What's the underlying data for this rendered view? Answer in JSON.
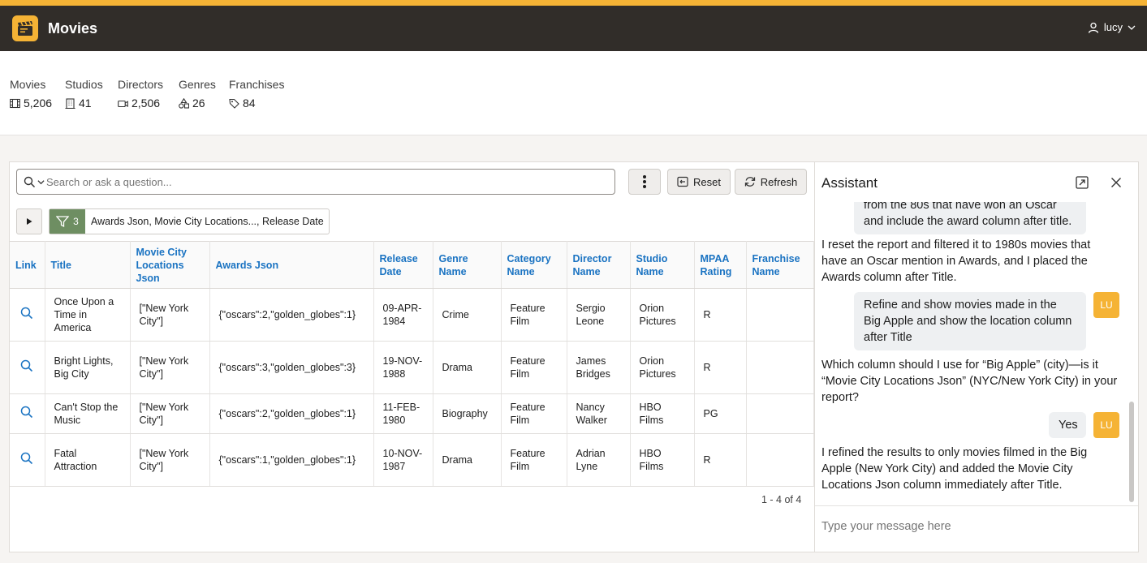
{
  "header": {
    "title": "Movies",
    "user": "lucy"
  },
  "stats": [
    {
      "label": "Movies",
      "value": "5,206",
      "icon": "film-icon"
    },
    {
      "label": "Studios",
      "value": "41",
      "icon": "building-icon"
    },
    {
      "label": "Directors",
      "value": "2,506",
      "icon": "camera-icon"
    },
    {
      "label": "Genres",
      "value": "26",
      "icon": "shapes-icon"
    },
    {
      "label": "Franchises",
      "value": "84",
      "icon": "tag-icon"
    }
  ],
  "toolbar": {
    "search_placeholder": "Search or ask a question...",
    "reset_label": "Reset",
    "refresh_label": "Refresh",
    "filter_count": "3",
    "filter_text": "Awards Json, Movie City Locations..., Release Date"
  },
  "table": {
    "columns": [
      "Link",
      "Title",
      "Movie City Locations Json",
      "Awards Json",
      "Release Date",
      "Genre Name",
      "Category Name",
      "Director Name",
      "Studio Name",
      "MPAA Rating",
      "Franchise Name"
    ],
    "rows": [
      [
        "",
        "Once Upon a Time in America",
        "[\"New York City\"]",
        "{\"oscars\":2,\"golden_globes\":1}",
        "09-APR-1984",
        "Crime",
        "Feature Film",
        "Sergio Leone",
        "Orion Pictures",
        "R",
        ""
      ],
      [
        "",
        "Bright Lights, Big City",
        "[\"New York City\"]",
        "{\"oscars\":3,\"golden_globes\":3}",
        "19-NOV-1988",
        "Drama",
        "Feature Film",
        "James Bridges",
        "Orion Pictures",
        "R",
        ""
      ],
      [
        "",
        "Can't Stop the Music",
        "[\"New York City\"]",
        "{\"oscars\":2,\"golden_globes\":1}",
        "11-FEB-1980",
        "Biography",
        "Feature Film",
        "Nancy Walker",
        "HBO Films",
        "PG",
        ""
      ],
      [
        "",
        "Fatal Attraction",
        "[\"New York City\"]",
        "{\"oscars\":1,\"golden_globes\":1}",
        "10-NOV-1987",
        "Drama",
        "Feature Film",
        "Adrian Lyne",
        "HBO Films",
        "R",
        ""
      ]
    ],
    "pagination": "1 - 4 of 4"
  },
  "assistant": {
    "title": "Assistant",
    "user_initials": "LU",
    "messages": [
      {
        "role": "user",
        "text": "from the 80s that have won an Oscar and include the award column after title."
      },
      {
        "role": "bot",
        "text": "I reset the report and filtered it to 1980s movies that have an Oscar mention in Awards, and I placed the Awards column after Title."
      },
      {
        "role": "user",
        "text": "Refine and show movies made in the Big Apple and show the location column after Title"
      },
      {
        "role": "bot",
        "text": "Which column should I use for “Big Apple” (city)—is it “Movie City Locations Json” (NYC/New York City) in your report?"
      },
      {
        "role": "user",
        "text": "Yes"
      },
      {
        "role": "bot",
        "text": "I refined the results to only movies filmed in the Big Apple (New York City) and added the Movie City Locations Json column immediately after Title."
      }
    ],
    "input_placeholder": "Type your message here"
  }
}
